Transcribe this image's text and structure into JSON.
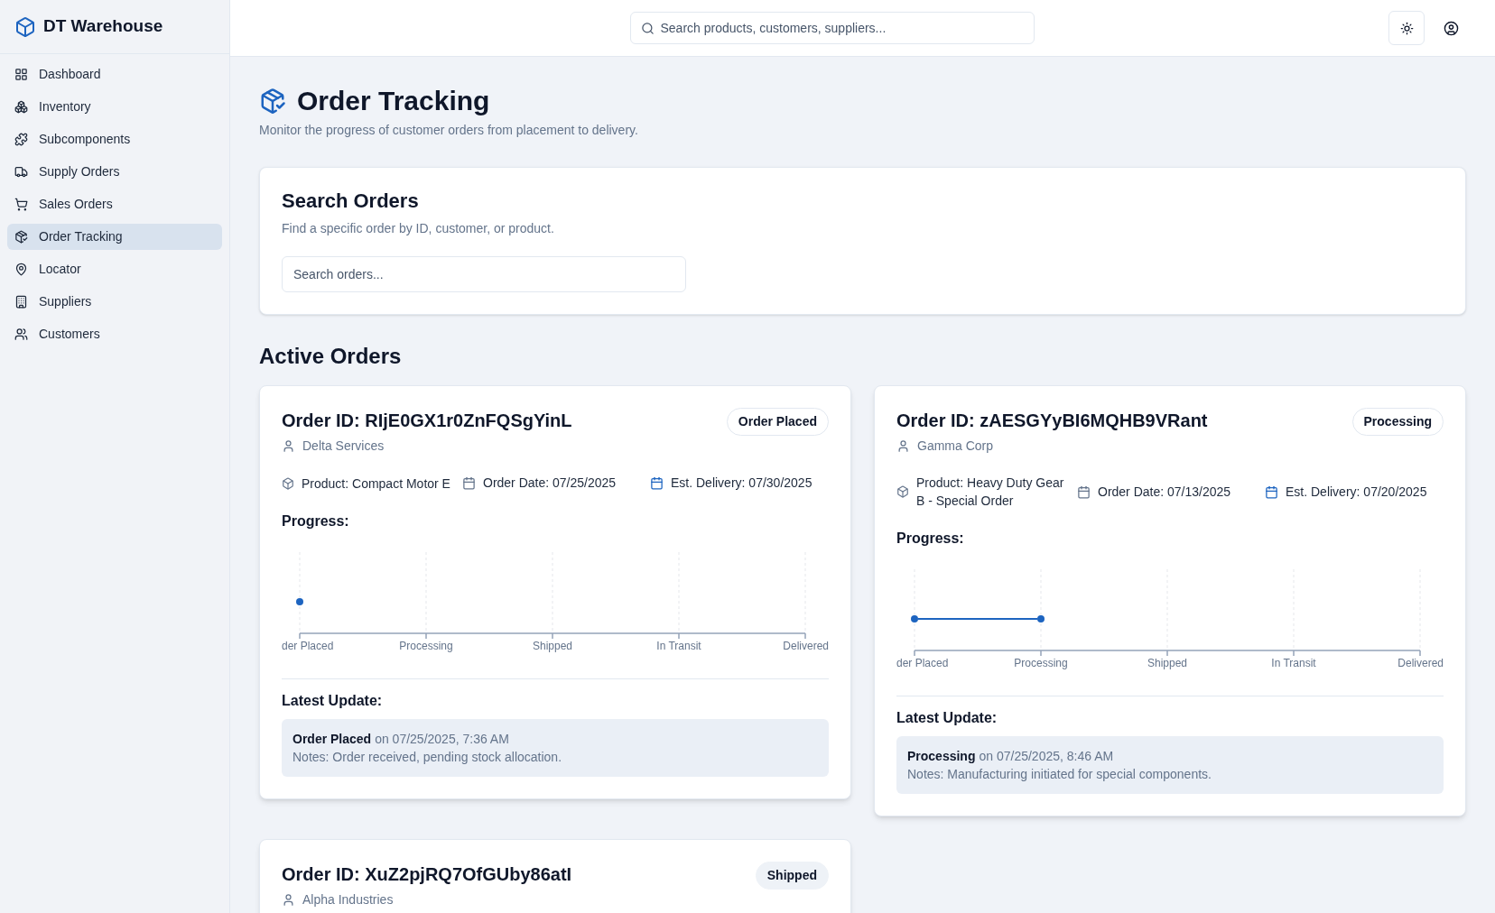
{
  "app": {
    "name": "DT Warehouse"
  },
  "sidebar": {
    "items": [
      {
        "label": "Dashboard",
        "selected": false
      },
      {
        "label": "Inventory",
        "selected": false
      },
      {
        "label": "Subcomponents",
        "selected": false
      },
      {
        "label": "Supply Orders",
        "selected": false
      },
      {
        "label": "Sales Orders",
        "selected": false
      },
      {
        "label": "Order Tracking",
        "selected": true
      },
      {
        "label": "Locator",
        "selected": false
      },
      {
        "label": "Suppliers",
        "selected": false
      },
      {
        "label": "Customers",
        "selected": false
      }
    ]
  },
  "header": {
    "search": {
      "placeholder": "Search products, customers, suppliers..."
    }
  },
  "page": {
    "title": "Order Tracking",
    "subtitle": "Monitor the progress of customer orders from placement to delivery."
  },
  "search_card": {
    "title": "Search Orders",
    "description": "Find a specific order by ID, customer, or product.",
    "field": {
      "placeholder": "Search orders..."
    }
  },
  "section_title": "Active Orders",
  "orders": [
    {
      "id": "Order ID: RIjE0GX1r0ZnFQSgYinL",
      "status": {
        "label": "Order Placed",
        "kind": "outline"
      },
      "customer": "Delta Services",
      "product": "Product: Compact Motor E",
      "order_date": "Order Date: 07/25/2025",
      "delivery": "Est. Delivery: 07/30/2025",
      "progress_label": "Progress:",
      "stages": [
        {
          "label": "der Placed",
          "reached": true
        },
        {
          "label": "Processing",
          "reached": false
        },
        {
          "label": "Shipped",
          "reached": false
        },
        {
          "label": "In Transit",
          "reached": false
        },
        {
          "label": "Delivered",
          "reached": false
        }
      ],
      "update_label": "Latest Update:",
      "update_status": "Order Placed",
      "update_time": "on 07/25/2025, 7:36 AM",
      "update_notes": "Notes: Order received, pending stock allocation."
    },
    {
      "id": "Order ID: zAESGYyBI6MQHB9VRant",
      "status": {
        "label": "Processing",
        "kind": "outline"
      },
      "customer": "Gamma Corp",
      "product": "Product: Heavy Duty Gear B - Special Order",
      "order_date": "Order Date: 07/13/2025",
      "delivery": "Est. Delivery: 07/20/2025",
      "progress_label": "Progress:",
      "stages": [
        {
          "label": "der Placed",
          "reached": true
        },
        {
          "label": "Processing",
          "reached": true
        },
        {
          "label": "Shipped",
          "reached": false
        },
        {
          "label": "In Transit",
          "reached": false
        },
        {
          "label": "Delivered",
          "reached": false
        }
      ],
      "update_label": "Latest Update:",
      "update_status": "Processing",
      "update_time": "on 07/25/2025, 8:46 AM",
      "update_notes": "Notes: Manufacturing initiated for special components."
    },
    {
      "id": "Order ID: XuZ2pjRQ7OfGUby86atI",
      "status": {
        "label": "Shipped",
        "kind": "filled"
      },
      "customer": "Alpha Industries"
    }
  ]
}
